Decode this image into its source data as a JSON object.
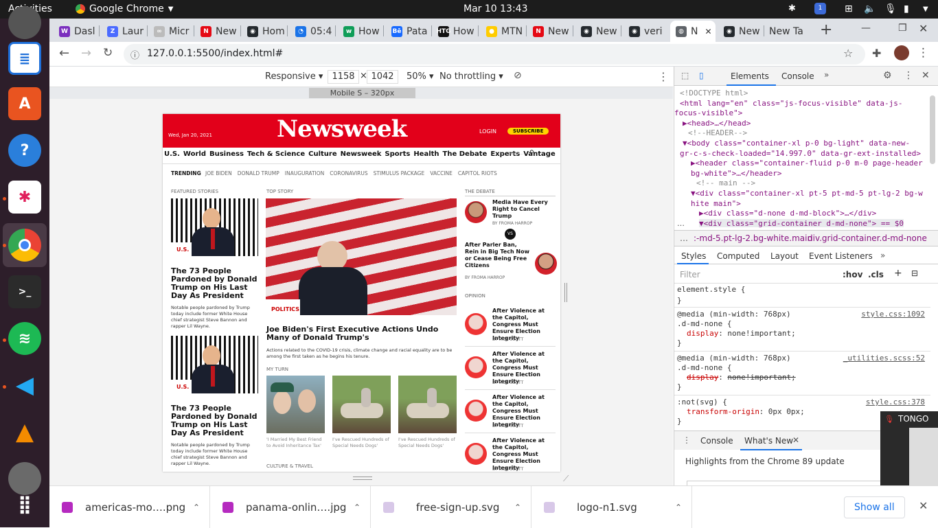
{
  "topbar": {
    "activities": "Activities",
    "app": "Google Chrome",
    "datetime": "Mar 10  13:43",
    "notif_count": "1"
  },
  "tabs": [
    {
      "label": "Dasl",
      "color": "#7b2fbe",
      "glyph": "W"
    },
    {
      "label": "Laur",
      "color": "#4b6bff",
      "glyph": "Z"
    },
    {
      "label": "Micr",
      "color": "#bbbbbb",
      "glyph": "∞"
    },
    {
      "label": "New",
      "color": "#e50914",
      "glyph": "N"
    },
    {
      "label": "Hom",
      "color": "#24292e",
      "glyph": "◉"
    },
    {
      "label": "05:4",
      "color": "#1a73e8",
      "glyph": "◔"
    },
    {
      "label": "How",
      "color": "#0f9d58",
      "glyph": "w"
    },
    {
      "label": "Pata",
      "color": "#1769ff",
      "glyph": "Bē"
    },
    {
      "label": "How",
      "color": "#111111",
      "glyph": "HTG"
    },
    {
      "label": "MTN",
      "color": "#ffcc00",
      "glyph": "●"
    },
    {
      "label": "New",
      "color": "#e50914",
      "glyph": "N"
    },
    {
      "label": "New",
      "color": "#24292e",
      "glyph": "◉"
    },
    {
      "label": "veri",
      "color": "#24292e",
      "glyph": "◉"
    },
    {
      "label": "N",
      "color": "#5f6368",
      "glyph": "◍"
    },
    {
      "label": "New",
      "color": "#24292e",
      "glyph": "◉"
    },
    {
      "label": "New Ta",
      "color": "#dee1e6",
      "glyph": ""
    }
  ],
  "address": {
    "url": "127.0.0.1:5500/index.html#"
  },
  "devicebar": {
    "device": "Responsive",
    "width": "1158",
    "height": "1042",
    "zoom": "50%",
    "throttle": "No throttling",
    "media_label": "Mobile S – 320px"
  },
  "newsweek": {
    "date": "Wed, Jan 20, 2021",
    "logo": "Newsweek",
    "login": "LOGIN",
    "subscribe": "SUBSCRIBE",
    "nav": [
      "U.S.",
      "World",
      "Business",
      "Tech & Science",
      "Culture",
      "Newsweek",
      "Sports",
      "Health",
      "The Debate",
      "Experts",
      "Vantage"
    ],
    "search_placeholder": "Search...",
    "trending_label": "TRENDING",
    "trending": [
      "JOE BIDEN",
      "DONALD TRUMP",
      "INAUGURATION",
      "CORONAVIRUS",
      "STIMULUS PACKAGE",
      "VACCINE",
      "CAPITOL RIOTS"
    ],
    "featured_label": "FEATURED STORIES",
    "featured": [
      {
        "tag": "U.S.",
        "title": "The 73 People Pardoned by Donald Trump on His Last Day As President",
        "desc": "Notable people pardoned by Trump today include former White House chief strategist Steve Bannon and rapper Lil Wayne."
      },
      {
        "tag": "U.S.",
        "title": "The 73 People Pardoned by Donald Trump on His Last Day As President",
        "desc": "Notable people pardoned by Trump today include former White House chief strategist Steve Bannon and rapper Lil Wayne."
      }
    ],
    "top_label": "TOP STORY",
    "top": {
      "tag": "POLITICS",
      "title": "Joe Biden's First Executive Actions Undo Many of Donald Trump's",
      "desc": "Actions related to the COVID-19 crisis, climate change and racial equality are to be among the first taken as he begins his tenure."
    },
    "myturn_label": "MY TURN",
    "myturn": [
      "'I Married My Best Friend to Avoid Inheritance Tax'",
      "I've Rescued Hundreds of Special Needs Dogs'",
      "I've Rescued Hundreds of Special Needs Dogs'"
    ],
    "culture_label": "CULTURE & TRAVEL",
    "debate_label": "THE DEBATE",
    "debate": [
      {
        "title": "Media Have Every Right to Cancel Trump",
        "by": "BY FROMA HARROP"
      },
      {
        "title": "After Parler Ban, Rein in Big Tech Now or Cease Being Free Citizens",
        "by": "BY FROMA HARROP"
      }
    ],
    "vs": "VS",
    "opinion_label": "OPINION",
    "opinion": [
      {
        "title": "After Violence at the Capitol, Congress Must Ensure Election Integrity",
        "by": "BY RICK SCOTT"
      },
      {
        "title": "After Violence at the Capitol, Congress Must Ensure Election Integrity",
        "by": "BY RICK SCOTT"
      },
      {
        "title": "After Violence at the Capitol, Congress Must Ensure Election Integrity",
        "by": "BY RICK SCOTT"
      },
      {
        "title": "After Violence at the Capitol, Congress Must Ensure Election Integrity",
        "by": "BY RICK SCOTT"
      }
    ]
  },
  "devtools": {
    "tabs": {
      "elements": "Elements",
      "console": "Console"
    },
    "dom": [
      "<!DOCTYPE html>",
      "<html lang=\"en\" class=\"js-focus-visible\" data-js-",
      "focus-visible\">",
      "▶<head>…</head>",
      "<!--HEADER-->",
      "▼<body class=\"container-xl p-0 bg-light\" data-new-",
      "gr-c-s-check-loaded=\"14.997.0\" data-gr-ext-installed>",
      "▶<header class=\"container-fluid p-0 m-0 page-header",
      "bg-white\">…</header>",
      "<!-- main -->",
      "▼<div class=\"container-xl pt-5 pt-md-5 pt-lg-2 bg-w",
      "hite main\">",
      "▶<div class=\"d-none d-md-block\">…</div>",
      "▼<div class=\"grid-container d-md-none\"> == $0"
    ],
    "breadcrumbs": [
      ":-md-5.pt-lg-2.bg-white.main",
      "div.grid-container.d-md-none"
    ],
    "styles_tabs": [
      "Styles",
      "Computed",
      "Layout",
      "Event Listeners"
    ],
    "filter_placeholder": "Filter",
    "hov": ":hov",
    "cls": ".cls",
    "rules": [
      {
        "sel": "element.style {",
        "lines": [
          "}"
        ],
        "src": ""
      },
      {
        "media": "@media (min-width: 768px)",
        "sel": ".d-md-none {",
        "prop": "display",
        "val": "none!important;",
        "src": "style.css:1092",
        "struck": false
      },
      {
        "media": "@media (min-width: 768px)",
        "sel": ".d-md-none {",
        "prop": "display",
        "val": "none!important;",
        "src": "_utilities.scss:52",
        "struck": true
      },
      {
        "sel": ":not(svg) {",
        "prop": "transform-origin",
        "val": "0px 0px;",
        "src": "style.css:378"
      }
    ],
    "drawer_tabs": {
      "console": "Console",
      "whatsnew": "What's New"
    },
    "whatsnew_text": "Highlights from the Chrome 89 update",
    "video_name": "TONGO"
  },
  "downloads": {
    "items": [
      "americas-mo….png",
      "panama-onlin….jpg",
      "free-sign-up.svg",
      "logo-n1.svg"
    ],
    "show_all": "Show all"
  }
}
